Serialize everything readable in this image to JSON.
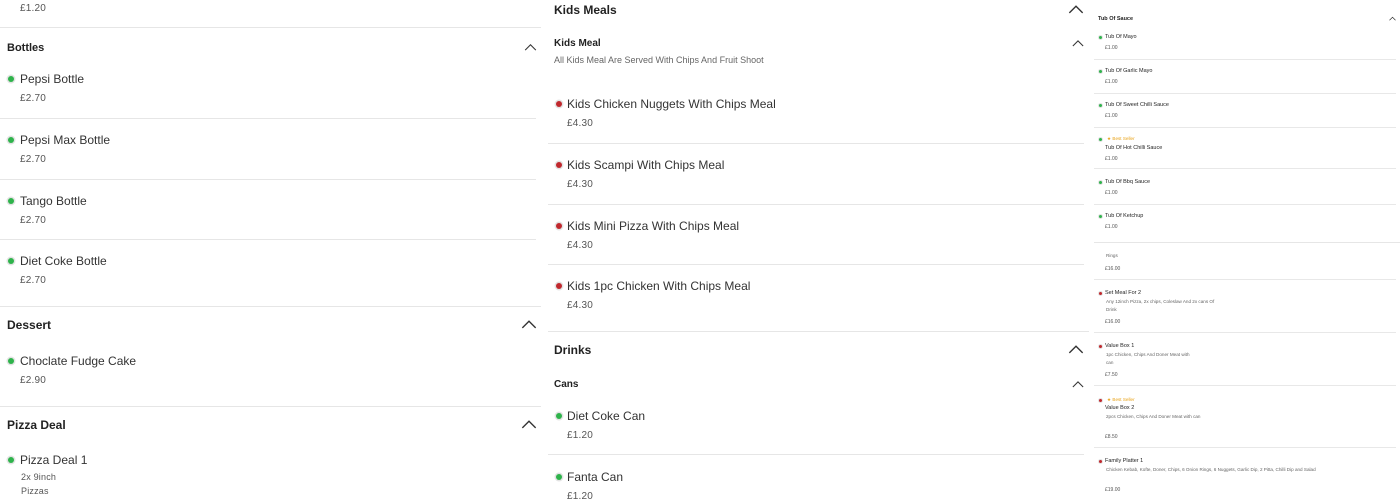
{
  "col1": {
    "top_price": "£1.20",
    "bottles": {
      "title": "Bottles",
      "items": [
        {
          "name": "Pepsi Bottle",
          "price": "£2.70"
        },
        {
          "name": "Pepsi Max Bottle",
          "price": "£2.70"
        },
        {
          "name": "Tango Bottle",
          "price": "£2.70"
        },
        {
          "name": "Diet Coke Bottle",
          "price": "£2.70"
        }
      ]
    },
    "dessert": {
      "title": "Dessert",
      "items": [
        {
          "name": "Choclate Fudge Cake",
          "price": "£2.90"
        }
      ]
    },
    "pizza_deal": {
      "title": "Pizza Deal",
      "items": [
        {
          "name": "Pizza Deal 1",
          "desc1": "2x 9inch",
          "desc2": "Pizzas"
        }
      ]
    }
  },
  "col2": {
    "kids_meals": {
      "title": "Kids Meals",
      "sub_title": "Kids Meal",
      "sub_desc": "All Kids Meal Are Served With Chips And Fruit Shoot",
      "items": [
        {
          "name": "Kids Chicken Nuggets With Chips Meal",
          "price": "£4.30"
        },
        {
          "name": "Kids Scampi With Chips Meal",
          "price": "£4.30"
        },
        {
          "name": "Kids Mini Pizza With Chips Meal",
          "price": "£4.30"
        },
        {
          "name": "Kids 1pc Chicken With Chips Meal",
          "price": "£4.30"
        }
      ]
    },
    "drinks": {
      "title": "Drinks",
      "sub_title": "Cans",
      "items": [
        {
          "name": "Diet Coke Can",
          "price": "£1.20"
        },
        {
          "name": "Fanta Can",
          "price": "£1.20"
        }
      ]
    }
  },
  "col3": {
    "title": "Tub Of Sauce",
    "sauces": [
      {
        "name": "Tub Of Mayo",
        "price": "£1.00"
      },
      {
        "name": "Tub Of Garlic Mayo",
        "price": "£1.00"
      },
      {
        "name": "Tub Of Sweet Chilli Sauce",
        "price": "£1.00"
      },
      {
        "name": "Tub Of Hot Chilli Sauce",
        "price": "£1.00",
        "badge": "★ Best Seller"
      },
      {
        "name": "Tub Of Bbq Sauce",
        "price": "£1.00"
      },
      {
        "name": "Tub Of Ketchup",
        "price": "£1.00"
      }
    ],
    "partial": {
      "desc": "Rings",
      "price": "£16.00"
    },
    "meals": [
      {
        "name": "Set Meal For 2",
        "desc": "Any 12inch Pizza, 2x chips, Coleslaw And 2x cans Of Drink",
        "price": "£16.00"
      },
      {
        "name": "Value Box 1",
        "desc": "1pc Chicken, Chips And Doner Meat with can",
        "price": "£7.50"
      },
      {
        "name": "Value Box 2",
        "desc": "2pcs Chicken, Chips And Doner Meat with can",
        "price": "£8.50",
        "badge": "★ Best Seller"
      },
      {
        "name": "Family Platter 1",
        "desc": "Chicken Kebab, Kofte, Doner, Chips, 6 Onion Rings, 6 Nuggets, Garlic Dip, 2 Pitta, Chilli Dip and Salad",
        "price": "£19.00"
      }
    ]
  }
}
